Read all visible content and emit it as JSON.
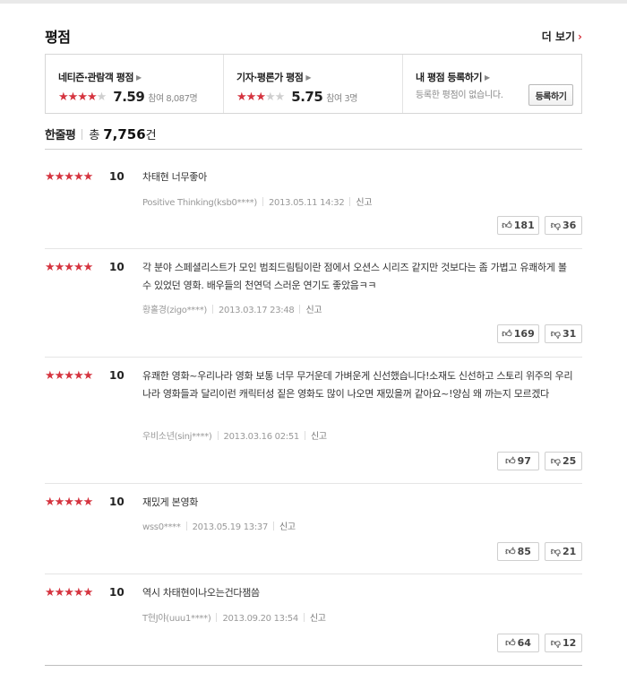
{
  "header": {
    "title": "평점",
    "more_label": "더 보기"
  },
  "score_box": {
    "netizen": {
      "label": "네티즌·관람객 평점",
      "stars": 4,
      "score": "7.59",
      "count": "참여 8,087명"
    },
    "critic": {
      "label": "기자·평론가 평점",
      "stars": 3,
      "score": "5.75",
      "count": "참여 3명"
    },
    "mine": {
      "label": "내 평점 등록하기",
      "desc": "등록한 평점이 없습니다.",
      "button": "등록하기"
    }
  },
  "reviews_header": {
    "title": "한줄평",
    "total_prefix": "총",
    "total": "7,756",
    "total_suffix": "건"
  },
  "reviews": [
    {
      "stars": "★★★★★",
      "score": "10",
      "text": "차태현 너무좋아",
      "author": "Positive Thinking(ksb0****)",
      "date": "2013.05.11 14:32",
      "report": "신고",
      "up": "181",
      "down": "36"
    },
    {
      "stars": "★★★★★",
      "score": "10",
      "text": "각 분야 스페셜리스트가 모인 범죄드림팀이란 점에서 오션스 시리즈 같지만 것보다는 좀 가볍고 유쾌하게 볼 수 있었던 영화. 배우들의 천연덕 스러운 연기도 좋았음ㅋㅋ",
      "author": "황홀경(zigo****)",
      "date": "2013.03.17 23:48",
      "report": "신고",
      "up": "169",
      "down": "31"
    },
    {
      "stars": "★★★★★",
      "score": "10",
      "text": "유쾌한 영화~우리나라 영화 보통 너무 무거운데 가벼운게 신선했습니다!소재도 신선하고 스토리 위주의 우리나라 영화들과 달리이런 캐릭터성 짙은 영화도 많이 나오면 재밌을꺼 같아요~!양심 왜 까는지 모르겠다",
      "author": "우비소년(sinj****)",
      "date": "2013.03.16 02:51",
      "report": "신고",
      "up": "97",
      "down": "25"
    },
    {
      "stars": "★★★★★",
      "score": "10",
      "text": "재밌게 본영화",
      "author": "wss0****",
      "date": "2013.05.19 13:37",
      "report": "신고",
      "up": "85",
      "down": "21"
    },
    {
      "stars": "★★★★★",
      "score": "10",
      "text": "역시 차태현이나오는건다잼씀",
      "author": "T현J야(uuu1****)",
      "date": "2013.09.20 13:54",
      "report": "신고",
      "up": "64",
      "down": "12"
    }
  ],
  "icons": {
    "thumb_up": "thumbs-up-icon",
    "thumb_down": "thumbs-down-icon",
    "star": "star-icon",
    "chevron": "chevron-right-icon"
  },
  "colors": {
    "accent": "#d5343f",
    "star_off": "#cfcfcf"
  }
}
